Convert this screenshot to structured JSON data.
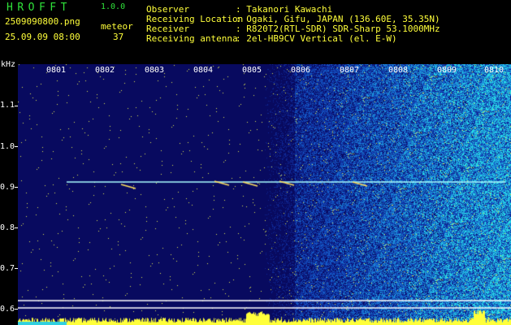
{
  "header": {
    "app_title": "HROFFT",
    "version": "1.0.0",
    "filename": "2509090800.png",
    "datetime": "25.09.09 08:00",
    "meteor_label": "meteor",
    "meteor_count": "37"
  },
  "info": [
    {
      "key": "Observer",
      "value": ": Takanori Kawachi"
    },
    {
      "key": "Receiving Location",
      "value": ": Ogaki, Gifu, JAPAN (136.60E, 35.35N)"
    },
    {
      "key": "Receiver",
      "value": ": R820T2(RTL-SDR) SDR-Sharp 53.1000MHz"
    },
    {
      "key": "Receiving antenna",
      "value": ": 2el-HB9CV Vertical (el. E-W)"
    }
  ],
  "spectrogram": {
    "unit": "kHz",
    "hour_ticks": [
      "0801",
      "0802",
      "0803",
      "0804",
      "0805",
      "0806",
      "0807",
      "0808",
      "0809",
      "0810"
    ],
    "freq_labels": [
      "1.1",
      "1.0",
      "0.9",
      "0.8",
      "0.7",
      "0.6"
    ],
    "colors": {
      "background": "#0a0a5a",
      "signal_line": "#aaffff",
      "noise_high": "#2fd0e0",
      "baseline": "#ffff3a"
    }
  }
}
